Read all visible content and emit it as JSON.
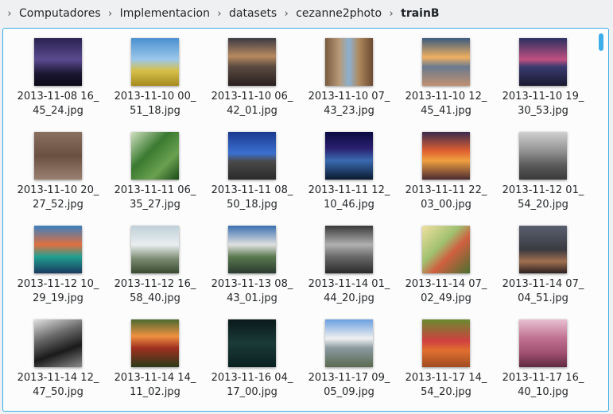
{
  "breadcrumb": [
    "Computadores",
    "Implementacion",
    "datasets",
    "cezanne2photo",
    "trainB"
  ],
  "files": [
    {
      "l1": "2013-11-08 16_",
      "l2": "45_24.jpg",
      "bg": "linear-gradient(180deg,#2a2350 0%,#5a4a90 45%,#1a1630 75%,#0c0a18 100%)"
    },
    {
      "l1": "2013-11-10 00_",
      "l2": "51_18.jpg",
      "bg": "linear-gradient(180deg,#4a90d0 0%,#9cc8ea 45%,#d6c04a 68%,#a68a1e 100%)"
    },
    {
      "l1": "2013-11-10 06_",
      "l2": "42_01.jpg",
      "bg": "linear-gradient(180deg,#3c3a44 0%,#b88a60 38%,#5a4a40 60%,#2a2020 100%)"
    },
    {
      "l1": "2013-11-10 07_",
      "l2": "43_23.jpg",
      "bg": "linear-gradient(90deg,#7a5a40 0%,#b89a78 30%,#8ab0d0 50%,#b08a60 70%,#6a4a30 100%)"
    },
    {
      "l1": "2013-11-10 12_",
      "l2": "45_41.jpg",
      "bg": "linear-gradient(180deg,#3a5a80 0%,#f0b060 40%,#6a7a90 60%,#c09070 100%)"
    },
    {
      "l1": "2013-11-10 19_",
      "l2": "30_53.jpg",
      "bg": "linear-gradient(180deg,#2a3060 0%,#c05080 45%,#3a3a70 60%,#1a1a30 100%)"
    },
    {
      "l1": "2013-11-10 20_",
      "l2": "27_52.jpg",
      "bg": "linear-gradient(180deg,#8a7060 0%,#6a5040 50%,#9a8070 100%)"
    },
    {
      "l1": "2013-11-11 06_",
      "l2": "35_27.jpg",
      "bg": "linear-gradient(135deg,#cfe0c0 0%,#3a7a30 40%,#6aa050 70%,#1a4a18 100%)"
    },
    {
      "l1": "2013-11-11 08_",
      "l2": "50_18.jpg",
      "bg": "linear-gradient(180deg,#1a3a90 0%,#3a70d0 45%,#4a4a4a 62%,#2a2a2a 100%)"
    },
    {
      "l1": "2013-11-11 12_",
      "l2": "10_46.jpg",
      "bg": "linear-gradient(180deg,#0a0a40 0%,#2a2070 35%,#3a6ab0 60%,#0a1a30 100%)"
    },
    {
      "l1": "2013-11-11 22_",
      "l2": "03_00.jpg",
      "bg": "linear-gradient(180deg,#3a2a50 0%,#e06030 40%,#f0a040 60%,#4a2a30 100%)"
    },
    {
      "l1": "2013-11-12 01_",
      "l2": "54_20.jpg",
      "bg": "linear-gradient(180deg,#d0d0d0 0%,#8a8a8a 45%,#5a5a5a 70%,#3a3a3a 100%)"
    },
    {
      "l1": "2013-11-12 10_",
      "l2": "29_19.jpg",
      "bg": "linear-gradient(180deg,#3a80c0 0%,#e07040 40%,#20a090 65%,#1a3a60 100%)"
    },
    {
      "l1": "2013-11-12 16_",
      "l2": "58_40.jpg",
      "bg": "linear-gradient(180deg,#c0d0d8 0%,#e8eef0 40%,#7a8a70 70%,#3a4a30 100%)"
    },
    {
      "l1": "2013-11-13 08_",
      "l2": "43_01.jpg",
      "bg": "linear-gradient(180deg,#3a70b0 0%,#e0e0e0 40%,#5a7a50 65%,#2a3a30 100%)"
    },
    {
      "l1": "2013-11-14 01_",
      "l2": "44_20.jpg",
      "bg": "linear-gradient(180deg,#3a3a3a 0%,#b0b0b0 40%,#6a6a6a 65%,#2a2a2a 100%)"
    },
    {
      "l1": "2013-11-14 07_",
      "l2": "02_49.jpg",
      "bg": "linear-gradient(135deg,#f0e0a0 0%,#a0c070 40%,#d06040 60%,#4a7030 100%)"
    },
    {
      "l1": "2013-11-14 07_",
      "l2": "04_51.jpg",
      "bg": "linear-gradient(180deg,#5a6070 0%,#3a3a40 50%,#a07050 75%,#2a2020 100%)"
    },
    {
      "l1": "2013-11-14 12_",
      "l2": "47_50.jpg",
      "bg": "linear-gradient(160deg,#e0e0e0 0%,#6a6a6a 35%,#1a1a1a 65%,#8a8a8a 100%)"
    },
    {
      "l1": "2013-11-14 14_",
      "l2": "11_02.jpg",
      "bg": "linear-gradient(180deg,#4a6a30 0%,#f09040 35%,#a03020 60%,#2a3a18 100%)"
    },
    {
      "l1": "2013-11-16 04_",
      "l2": "17_00.jpg",
      "bg": "linear-gradient(180deg,#0a1a1a 0%,#1a3a38 50%,#0a2020 100%)"
    },
    {
      "l1": "2013-11-17 09_",
      "l2": "05_09.jpg",
      "bg": "linear-gradient(180deg,#6aa0e0 0%,#f0f0f0 40%,#8a9aa0 60%,#5a6a50 100%)"
    },
    {
      "l1": "2013-11-17 14_",
      "l2": "54_20.jpg",
      "bg": "linear-gradient(180deg,#6a8a30 0%,#d04040 45%,#e07030 65%,#a04a20 100%)"
    },
    {
      "l1": "2013-11-17 16_",
      "l2": "40_10.jpg",
      "bg": "linear-gradient(180deg,#e8c0d0 0%,#c07090 40%,#a05070 70%,#602a40 100%)"
    }
  ]
}
